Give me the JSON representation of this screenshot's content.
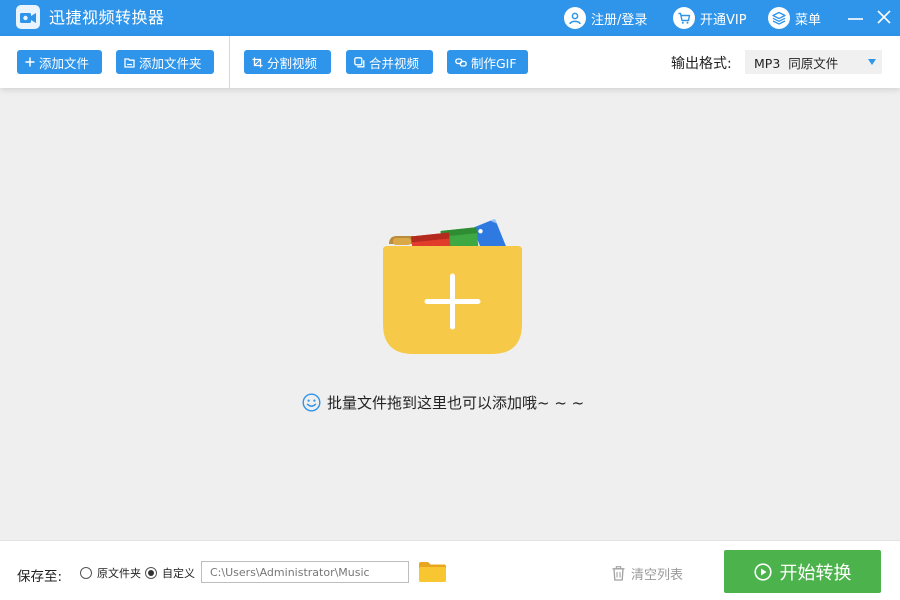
{
  "titlebar": {
    "app_title": "迅捷视频转换器",
    "login_label": "注册/登录",
    "vip_label": "开通VIP",
    "menu_label": "菜单"
  },
  "toolbar": {
    "add_file": "添加文件",
    "add_folder": "添加文件夹",
    "split_video": "分割视频",
    "merge_video": "合并视频",
    "make_gif": "制作GIF",
    "format_label": "输出格式:",
    "format_value": "MP3  同原文件"
  },
  "main": {
    "hint": "批量文件拖到这里也可以添加哦~ ~ ~"
  },
  "bottombar": {
    "save_label": "保存至:",
    "radio_original": "原文件夹",
    "radio_custom": "自定义",
    "selected_option": "自定义",
    "path_value": "C:\\Users\\Administrator\\Music",
    "clear_label": "清空列表",
    "start_label": "开始转换"
  },
  "colors": {
    "primary": "#2f95ea",
    "start_green": "#4cb34c",
    "folder_yellow": "#f7c948",
    "background": "#efefef"
  },
  "icons": [
    "app-logo-icon",
    "user-icon",
    "cart-icon",
    "layers-icon",
    "minimize-icon",
    "close-icon",
    "plus-icon",
    "folder-icon",
    "crop-icon",
    "merge-icon",
    "link-icon",
    "smile-icon",
    "trash-icon",
    "play-circle-icon"
  ]
}
